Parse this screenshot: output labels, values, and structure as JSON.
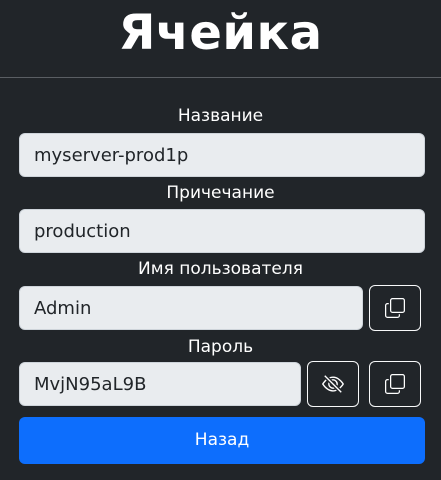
{
  "header": {
    "title": "Ячейка"
  },
  "form": {
    "name": {
      "label": "Название",
      "value": "myserver-prod1p"
    },
    "note": {
      "label": "Причечание",
      "value": "production"
    },
    "username": {
      "label": "Имя пользователя",
      "value": "Admin",
      "copy_icon": "copy-icon"
    },
    "password": {
      "label": "Пароль",
      "value": "MvjN95aL9B",
      "toggle_icon": "eye-slash-icon",
      "copy_icon": "copy-icon"
    }
  },
  "actions": {
    "back_label": "Назад"
  },
  "colors": {
    "background": "#212529",
    "field_background": "#e9ecef",
    "primary": "#0d6efd",
    "text_light": "#ffffff",
    "text_dark": "#212529"
  }
}
